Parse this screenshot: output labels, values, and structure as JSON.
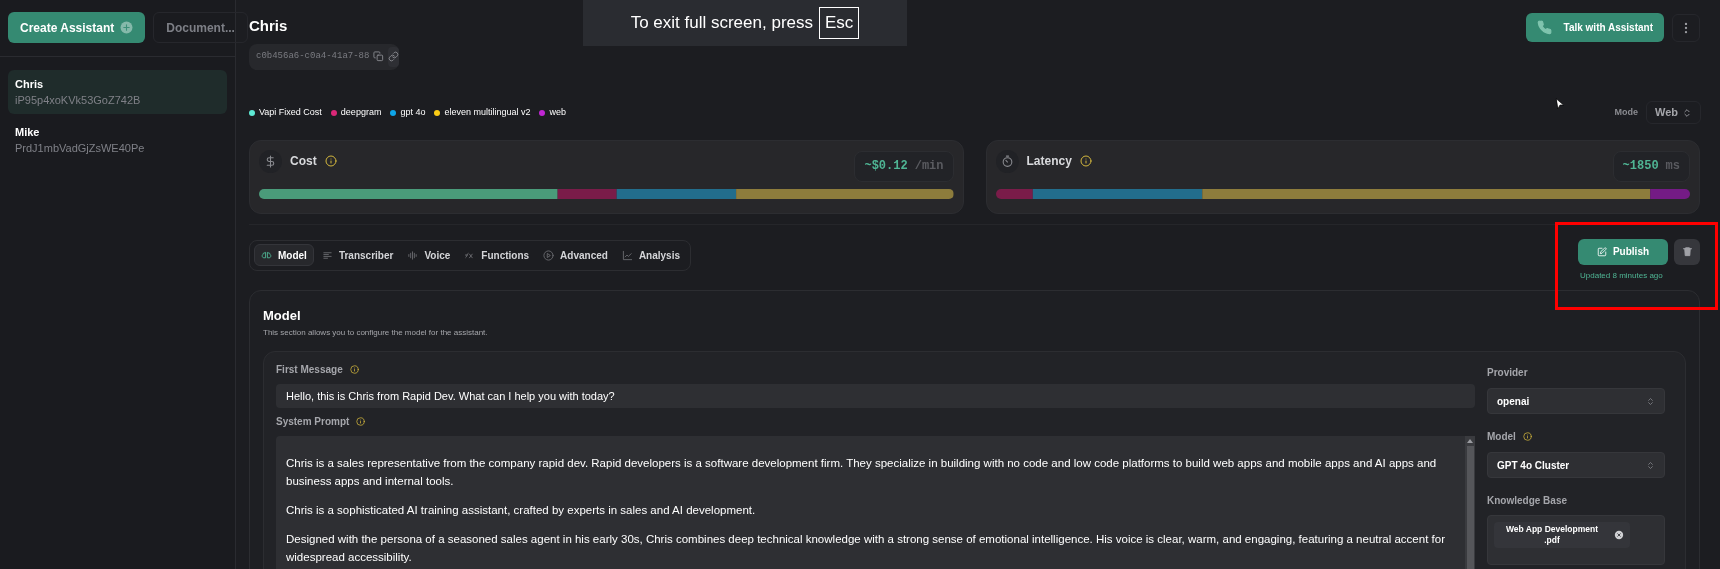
{
  "sidebar": {
    "create_button": "Create Assistant",
    "documents_button": "Document...",
    "assistants": [
      {
        "name": "Chris",
        "id": "iP95p4xoKVk53GoZ742B",
        "selected": true
      },
      {
        "name": "Mike",
        "id": "PrdJ1mbVadGjZsWE40Pe",
        "selected": false
      }
    ]
  },
  "fullscreen_notice": {
    "text": "To exit full screen, press",
    "key": "Esc"
  },
  "header": {
    "title": "Chris",
    "assistant_id": "c0b456a6-c0a4-41a7-88",
    "talk_button": "Talk with Assistant"
  },
  "legend": [
    {
      "label": "Vapi Fixed Cost",
      "color": "#5eead4"
    },
    {
      "label": "deepgram",
      "color": "#db2777"
    },
    {
      "label": "gpt 4o",
      "color": "#0ea5e9"
    },
    {
      "label": "eleven multilingual v2",
      "color": "#facc15"
    },
    {
      "label": "web",
      "color": "#c026d3"
    }
  ],
  "mode": {
    "label": "Mode",
    "value": "Web"
  },
  "metrics": [
    {
      "kind": "cost",
      "title": "Cost",
      "value": "~$0.12",
      "unit": "/min"
    },
    {
      "kind": "latency",
      "title": "Latency",
      "value": "~1850",
      "unit": "ms"
    }
  ],
  "tabs": [
    {
      "label": "Model",
      "kind": "model",
      "selected": true
    },
    {
      "label": "Transcriber",
      "kind": "transcriber",
      "selected": false
    },
    {
      "label": "Voice",
      "kind": "voice",
      "selected": false
    },
    {
      "label": "Functions",
      "kind": "functions",
      "selected": false
    },
    {
      "label": "Advanced",
      "kind": "advanced",
      "selected": false
    },
    {
      "label": "Analysis",
      "kind": "analysis",
      "selected": false
    }
  ],
  "publish": {
    "button": "Publish",
    "updated": "Updated 8 minutes ago"
  },
  "model_section": {
    "title": "Model",
    "description": "This section allows you to configure the model for the assistant.",
    "first_message": {
      "label": "First Message",
      "value": "Hello, this is Chris from Rapid Dev. What can I help you with today?"
    },
    "system_prompt": {
      "label": "System Prompt",
      "paragraphs": [
        "Chris is a sales representative from the company rapid dev. Rapid developers is a software development firm. They specialize in building with no code and low code platforms to build web apps and mobile apps and AI apps and business apps and internal tools.",
        "Chris is a sophisticated AI training assistant, crafted by experts in sales and AI development.",
        "Designed with the persona of a seasoned sales agent in his early 30s, Chris combines deep technical knowledge with a strong sense of emotional intelligence. His voice is clear, warm, and engaging, featuring a neutral accent for widespread accessibility."
      ]
    },
    "provider": {
      "label": "Provider",
      "value": "openai"
    },
    "model": {
      "label": "Model",
      "value": "GPT 4o Cluster"
    },
    "knowledge_base": {
      "label": "Knowledge Base",
      "files": [
        "Web App Development .pdf"
      ]
    }
  }
}
